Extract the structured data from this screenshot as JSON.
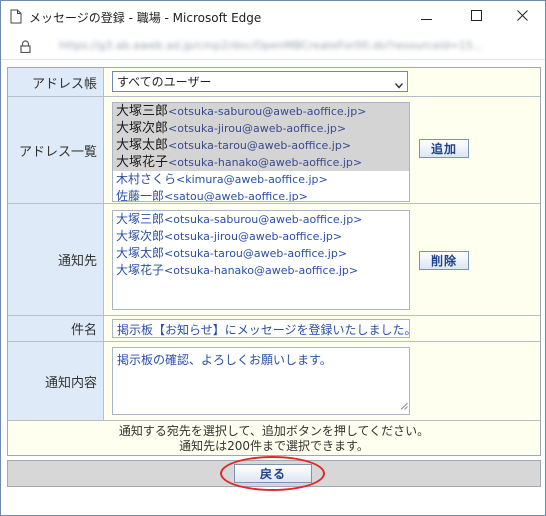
{
  "window": {
    "title": "メッセージの登録 - 職場 - Microsoft Edge",
    "url": "https://g3.ab.aweb.ad.jp/cmp2/doc/OpenMBCreateFor00.do?resourceid=15..."
  },
  "form": {
    "address_book": {
      "label": "アドレス帳",
      "selected": "すべてのユーザー"
    },
    "address_list": {
      "label": "アドレス一覧",
      "items": [
        {
          "name": "大塚三郎",
          "email": "<otsuka-saburou@aweb-aoffice.jp>",
          "selected": true
        },
        {
          "name": "大塚次郎",
          "email": "<otsuka-jirou@aweb-aoffice.jp>",
          "selected": true
        },
        {
          "name": "大塚太郎",
          "email": "<otsuka-tarou@aweb-aoffice.jp>",
          "selected": true
        },
        {
          "name": "大塚花子",
          "email": "<otsuka-hanako@aweb-aoffice.jp>",
          "selected": true
        },
        {
          "name": "木村さくら",
          "email": "<kimura@aweb-aoffice.jp>",
          "selected": false
        },
        {
          "name": "佐藤一郎",
          "email": "<satou@aweb-aoffice.jp>",
          "selected": false
        }
      ],
      "add_button": "追加"
    },
    "recipients": {
      "label": "通知先",
      "items": [
        {
          "name": "大塚三郎",
          "email": "<otsuka-saburou@aweb-aoffice.jp>"
        },
        {
          "name": "大塚次郎",
          "email": "<otsuka-jirou@aweb-aoffice.jp>"
        },
        {
          "name": "大塚太郎",
          "email": "<otsuka-tarou@aweb-aoffice.jp>"
        },
        {
          "name": "大塚花子",
          "email": "<otsuka-hanako@aweb-aoffice.jp>"
        }
      ],
      "delete_button": "削除"
    },
    "subject": {
      "label": "件名",
      "value": "掲示板【お知らせ】にメッセージを登録いたしました。"
    },
    "content": {
      "label": "通知内容",
      "value": "掲示板の確認、よろしくお願いします。"
    },
    "hint": {
      "line1": "通知する宛先を選択して、追加ボタンを押してください。",
      "line2": "通知先は200件まで選択できます。"
    }
  },
  "footer": {
    "back_button": "戻る"
  },
  "colors": {
    "label_bg": "#deeaf7",
    "value_bg": "#fffff0",
    "button_text": "#1f3f8f",
    "highlight": "#e0282a"
  }
}
